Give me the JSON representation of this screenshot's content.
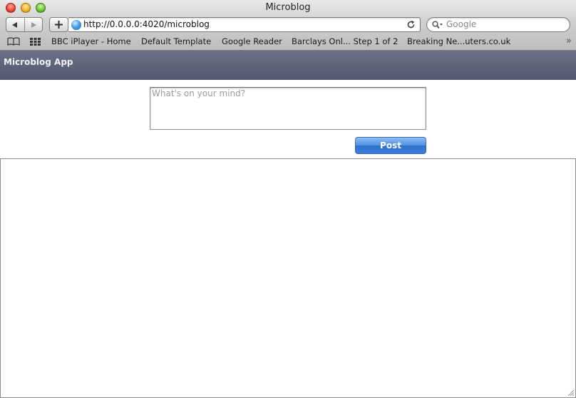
{
  "window": {
    "title": "Microblog"
  },
  "toolbar": {
    "url": "http://0.0.0.0:4020/microblog",
    "search_placeholder": "Google"
  },
  "bookmarks": [
    "BBC iPlayer - Home",
    "Default Template",
    "Google Reader",
    "Barclays Onl... Step 1 of 2",
    "Breaking Ne...uters.co.uk"
  ],
  "app": {
    "title": "Microblog App",
    "compose_placeholder": "What's on your mind?",
    "post_label": "Post"
  },
  "colors": {
    "header_bg": "#5d6379",
    "post_button": "#3c7fda"
  },
  "icons": {
    "back": "back-arrow-icon",
    "forward": "forward-arrow-icon",
    "add": "plus-icon",
    "site": "globe-icon",
    "reload": "reload-icon",
    "search": "search-icon",
    "bookmarks": "book-icon",
    "top_sites": "grid-icon",
    "more": "chevron-double-right-icon"
  }
}
